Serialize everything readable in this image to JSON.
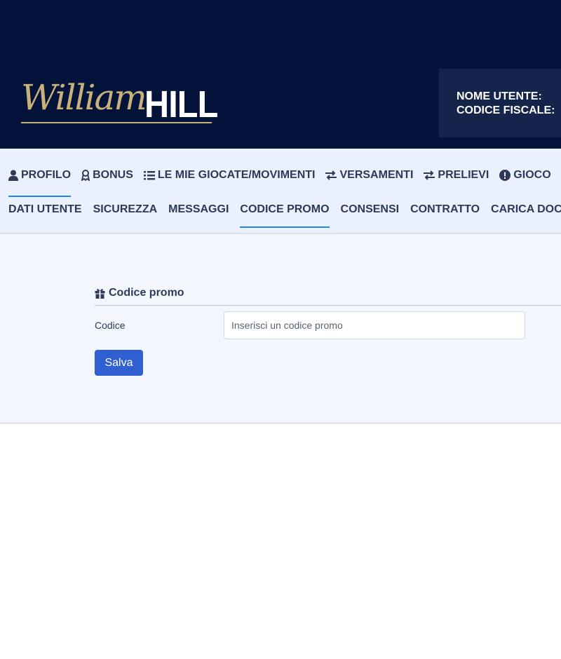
{
  "brand": {
    "script": "William",
    "bold": "HILL"
  },
  "user_box": {
    "username_label": "NOME UTENTE:",
    "fiscal_code_label": "CODICE FISCALE:"
  },
  "primary_tabs": [
    {
      "label": "PROFILO",
      "icon": "user-icon",
      "active": true
    },
    {
      "label": "BONUS",
      "icon": "ribbon-icon",
      "active": false
    },
    {
      "label": "LE MIE GIOCATE/MOVIMENTI",
      "icon": "list-icon",
      "active": false
    },
    {
      "label": "VERSAMENTI",
      "icon": "exchange-icon",
      "active": false
    },
    {
      "label": "PRELIEVI",
      "icon": "exchange-icon",
      "active": false
    },
    {
      "label": "GIOCO",
      "icon": "alert-icon",
      "active": false
    }
  ],
  "secondary_tabs": [
    {
      "label": "DATI UTENTE",
      "active": false
    },
    {
      "label": "SICUREZZA",
      "active": false
    },
    {
      "label": "MESSAGGI",
      "active": false
    },
    {
      "label": "CODICE PROMO",
      "active": true
    },
    {
      "label": "CONSENSI",
      "active": false
    },
    {
      "label": "CONTRATTO",
      "active": false
    },
    {
      "label": "CARICA DOC",
      "active": false
    }
  ],
  "promo_section": {
    "title": "Codice promo",
    "field_label": "Codice",
    "field_placeholder": "Inserisci un codice promo",
    "field_value": "",
    "save_label": "Salva"
  },
  "colors": {
    "header_bg": "#03133a",
    "nav_bg": "#eaf1fc",
    "accent_underline": "#1e88e5",
    "button_bg": "#2f5fd0",
    "logo_gold": "#c8b27a"
  }
}
